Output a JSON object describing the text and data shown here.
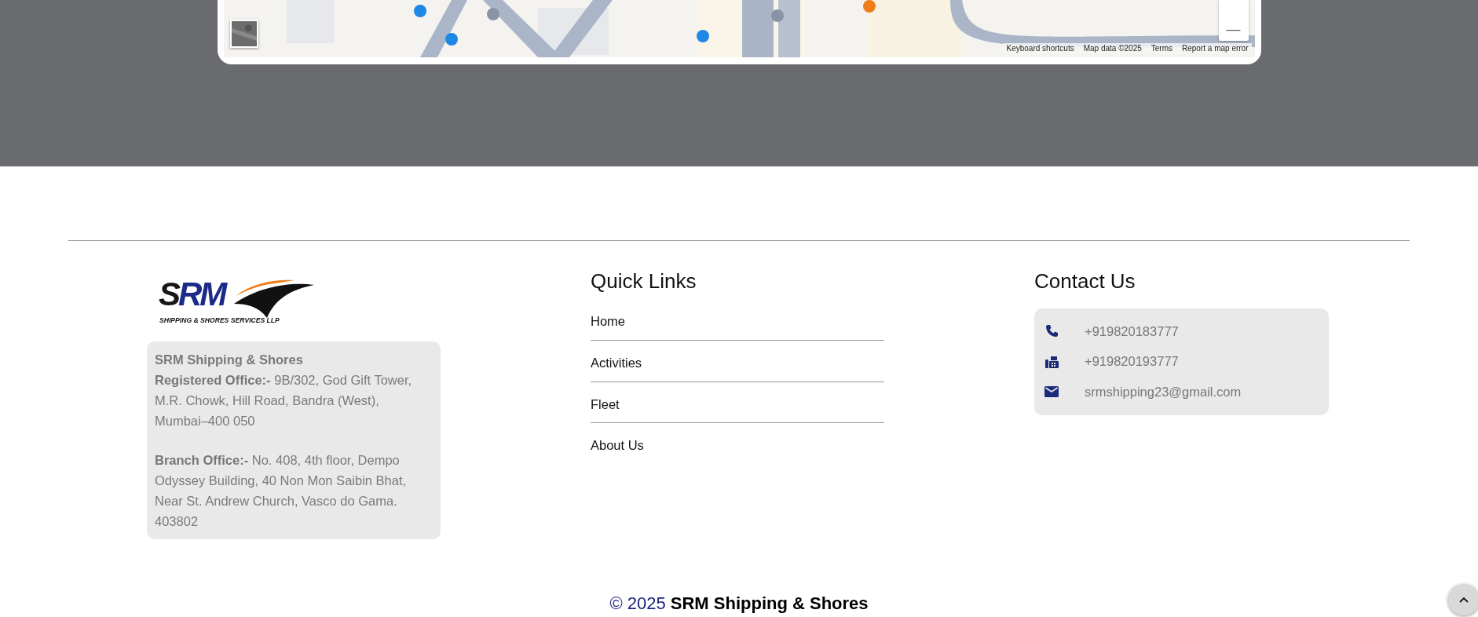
{
  "map": {
    "zoom_out": "—",
    "attribution": [
      "Keyboard shortcuts",
      "Map data ©2025",
      "Terms",
      "Report a map error"
    ]
  },
  "logo": {
    "mark": "SRM",
    "tagline": "SHIPPING & SHORES SERVICES LLP"
  },
  "address": {
    "company": "SRM Shipping & Shores",
    "offices": [
      "**Registered Office:-** 9B/302, God Gift Tower, M.R. Chowk, Hill Road, Bandra (West), Mumbai–400 050",
      "**Branch Office:-** No. 408, 4th floor, Dempo Odyssey Building, 40 Non Mon Saibin Bhat, Near St. Andrew Church, Vasco do Gama. 403802"
    ]
  },
  "quick_links": {
    "title": "Quick Links",
    "items": [
      "Home",
      "Activities",
      "Fleet",
      "About Us"
    ]
  },
  "contact": {
    "title": "Contact Us",
    "items": [
      {
        "kind": "phone",
        "text": "+919820183777"
      },
      {
        "kind": "fax",
        "text": "+919820193777"
      },
      {
        "kind": "email",
        "text": "srmshipping23@gmail.com"
      }
    ]
  },
  "copyright": "© 2025 **SRM Shipping & Shores**"
}
